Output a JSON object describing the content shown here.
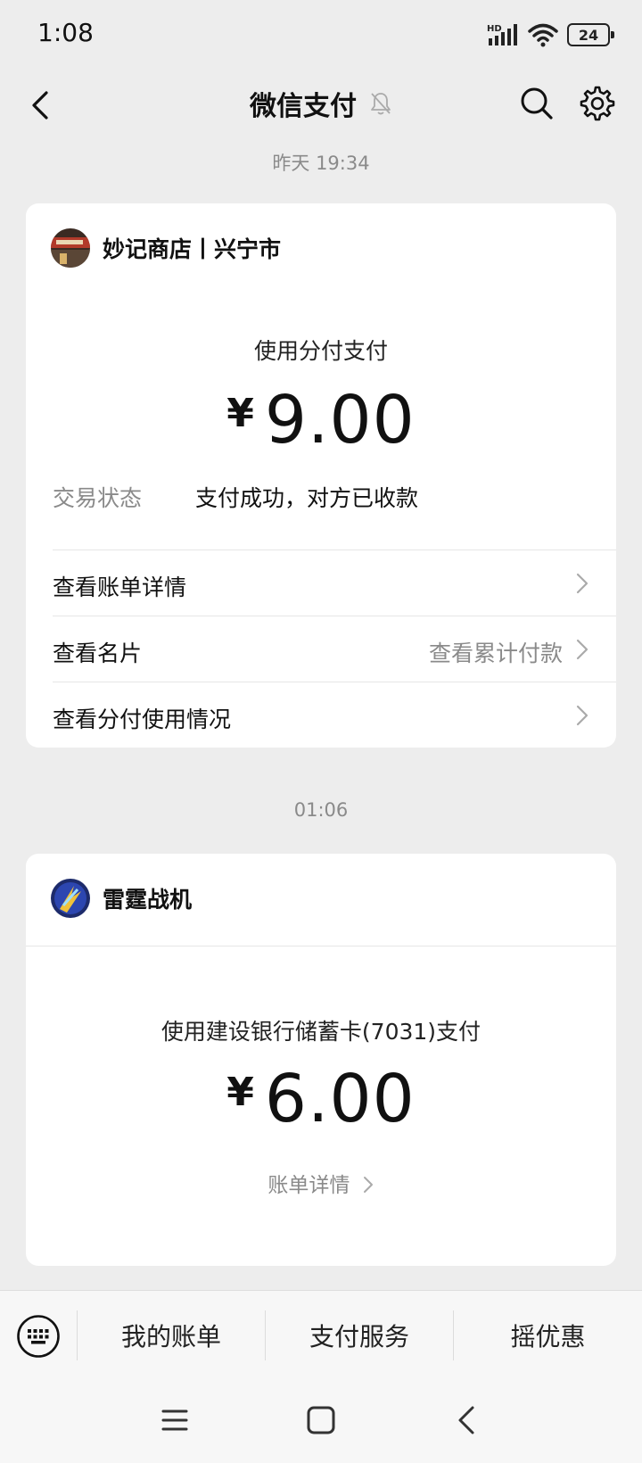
{
  "status_bar": {
    "time": "1:08",
    "network": "HD",
    "battery": "24"
  },
  "nav": {
    "title": "微信支付"
  },
  "messages": [
    {
      "timestamp": "昨天 19:34",
      "merchant": "妙记商店丨兴宁市",
      "pay_method": "使用分付支付",
      "currency": "¥",
      "amount": "9.00",
      "status_label": "交易状态",
      "status_value": "支付成功，对方已收款",
      "rows": [
        {
          "label": "查看账单详情",
          "extra": ""
        },
        {
          "label": "查看名片",
          "extra": "查看累计付款"
        },
        {
          "label": "查看分付使用情况",
          "extra": ""
        }
      ]
    },
    {
      "timestamp": "01:06",
      "merchant": "雷霆战机",
      "pay_method": "使用建设银行储蓄卡(7031)支付",
      "currency": "¥",
      "amount": "6.00",
      "bill_link": "账单详情"
    }
  ],
  "bottom_menu": {
    "items": [
      "我的账单",
      "支付服务",
      "摇优惠"
    ]
  },
  "colors": {
    "background": "#EDEDED",
    "card": "#FFFFFF",
    "secondary_text": "#8A8A8A"
  },
  "icons": {
    "back": "back-arrow-icon",
    "mute": "bell-muted-icon",
    "search": "search-icon",
    "settings": "gear-icon",
    "keyboard": "keyboard-icon"
  }
}
